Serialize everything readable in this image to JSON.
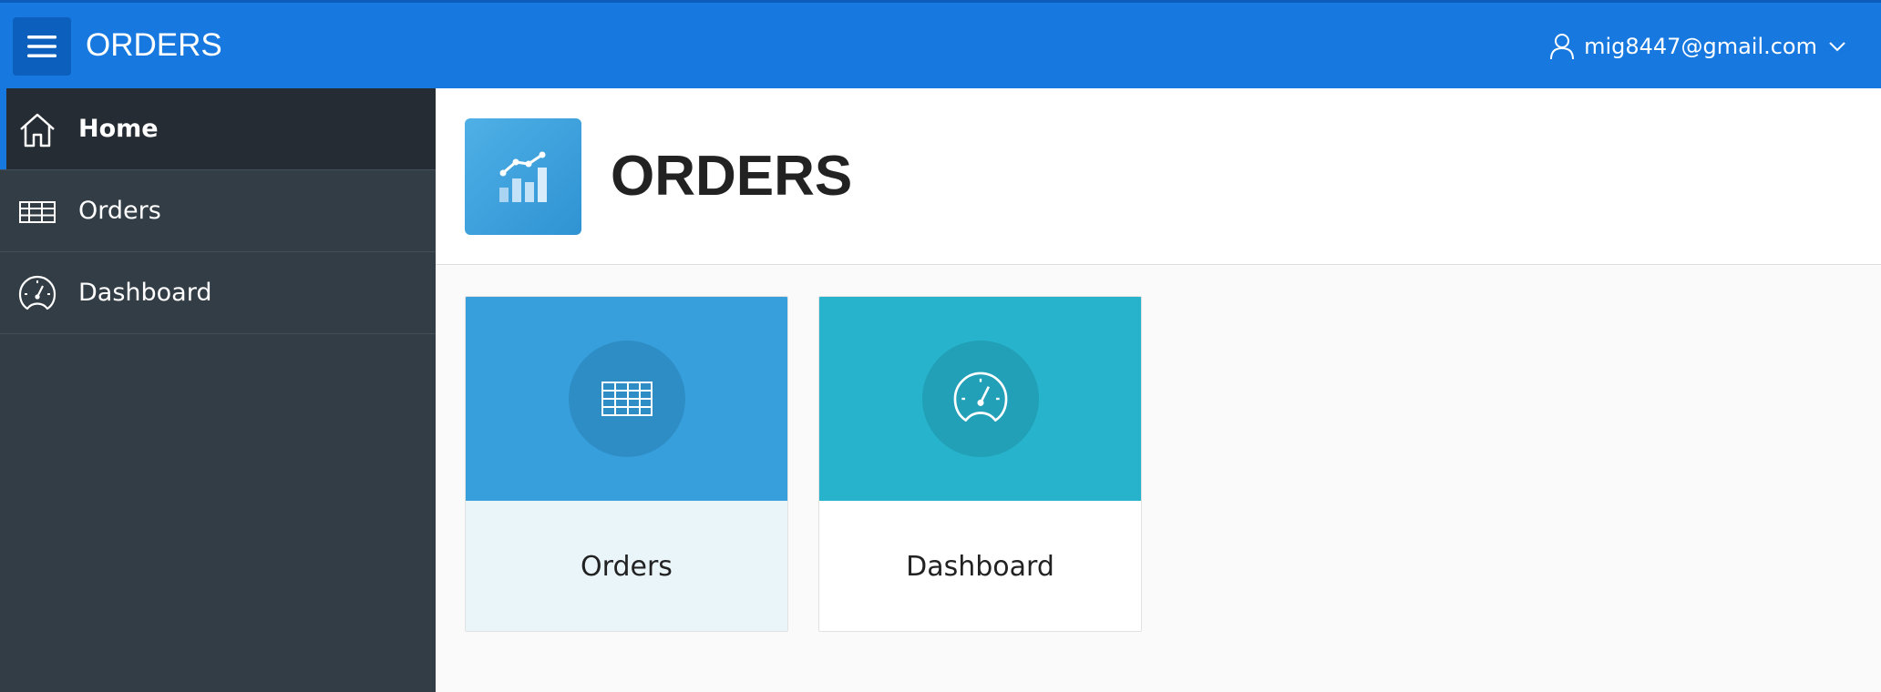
{
  "header": {
    "app_title": "ORDERS",
    "user_email": "mig8447@gmail.com",
    "icons": {
      "menu": "hamburger-menu-icon",
      "user": "user-icon",
      "dropdown": "chevron-down-icon"
    }
  },
  "sidebar": {
    "items": [
      {
        "label": "Home",
        "icon": "home-icon",
        "active": true
      },
      {
        "label": "Orders",
        "icon": "table-icon",
        "active": false
      },
      {
        "label": "Dashboard",
        "icon": "speedometer-icon",
        "active": false
      }
    ]
  },
  "hero": {
    "title": "ORDERS",
    "icon": "chart-icon"
  },
  "cards": [
    {
      "label": "Orders",
      "icon": "table-icon",
      "color": "#379fdb"
    },
    {
      "label": "Dashboard",
      "icon": "speedometer-icon",
      "color": "#27b3cc"
    }
  ],
  "colors": {
    "header": "#1779e0",
    "sidebar": "#333d46",
    "sidebar_active": "#262c33"
  }
}
